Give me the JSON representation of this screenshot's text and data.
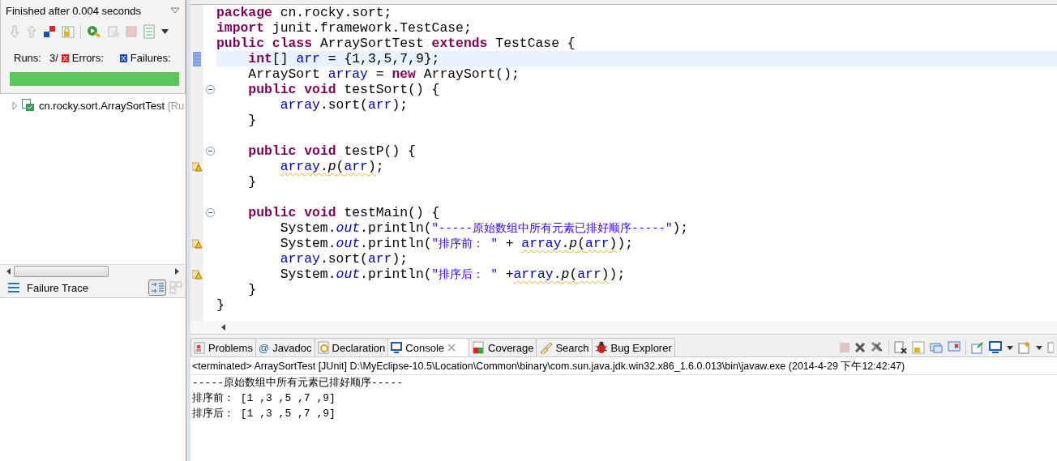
{
  "junit": {
    "status": "Finished after 0.004 seconds",
    "runs_label": "Runs:",
    "runs": "3/",
    "errors_label": "Errors:",
    "failures_label": "Failures:",
    "progress": {
      "level": 1
    },
    "tree": [
      {
        "label": "cn.rocky.sort.ArraySortTest",
        "suffix": "[Ru",
        "expanded": false
      }
    ],
    "failure_trace": "Failure Trace"
  },
  "editor": {
    "lines": [
      {
        "gap_before": false,
        "current": false,
        "tokens": [
          {
            "text": "package",
            "kind": "keyword",
            "squiggle": false
          },
          {
            "text": " cn.rocky.sort;",
            "kind": "plain",
            "squiggle": false
          }
        ]
      },
      {
        "gap_before": false,
        "current": false,
        "tokens": [
          {
            "text": "import",
            "kind": "keyword",
            "squiggle": false
          },
          {
            "text": " junit.framework.TestCase;",
            "kind": "plain",
            "squiggle": false
          }
        ]
      },
      {
        "gap_before": false,
        "current": false,
        "tokens": [
          {
            "text": "public ",
            "kind": "keyword",
            "squiggle": false
          },
          {
            "text": "class",
            "kind": "keyword",
            "squiggle": false
          },
          {
            "text": " ArraySortTest ",
            "kind": "plain",
            "squiggle": false
          },
          {
            "text": "extends",
            "kind": "keyword",
            "squiggle": false
          },
          {
            "text": " TestCase {",
            "kind": "plain",
            "squiggle": false
          }
        ],
        "children": [
          {
            "kind": "bookmark",
            "gap_before": false,
            "current": true,
            "tokens": [
              {
                "text": "int",
                "kind": "keyword",
                "squiggle": false
              },
              {
                "text": "[] ",
                "kind": "plain",
                "squiggle": false
              },
              {
                "text": "arr",
                "kind": "field",
                "squiggle": false
              },
              {
                "text": " = {1,3,5,7,9};",
                "kind": "plain",
                "squiggle": false
              }
            ]
          },
          {
            "gap_before": false,
            "current": false,
            "tokens": [
              {
                "text": "ArraySort ",
                "kind": "plain",
                "squiggle": false
              },
              {
                "text": "array",
                "kind": "field",
                "squiggle": false
              },
              {
                "text": " = ",
                "kind": "plain",
                "squiggle": false
              },
              {
                "text": "new",
                "kind": "keyword",
                "squiggle": false
              },
              {
                "text": " ArraySort();",
                "kind": "plain",
                "squiggle": false
              }
            ]
          },
          {
            "kind": "fold",
            "gap_before": false,
            "current": false,
            "tokens": [
              {
                "text": "public ",
                "kind": "keyword",
                "squiggle": false
              },
              {
                "text": "void",
                "kind": "keyword",
                "squiggle": false
              },
              {
                "text": " testSort() {",
                "kind": "plain",
                "squiggle": false
              }
            ],
            "children": [
              {
                "gap_before": false,
                "current": false,
                "tokens": [
                  {
                    "text": "array",
                    "kind": "field",
                    "squiggle": false
                  },
                  {
                    "text": ".sort(",
                    "kind": "plain",
                    "squiggle": false
                  },
                  {
                    "text": "arr",
                    "kind": "field",
                    "squiggle": false
                  },
                  {
                    "text": ");",
                    "kind": "plain",
                    "squiggle": false
                  }
                ]
              }
            ]
          },
          {
            "gap_before": false,
            "current": false,
            "tokens": [
              {
                "text": "}",
                "kind": "plain",
                "squiggle": false
              }
            ]
          },
          {
            "kind": "fold",
            "gap_before": true,
            "current": false,
            "tokens": [
              {
                "text": "public ",
                "kind": "keyword",
                "squiggle": false
              },
              {
                "text": "void",
                "kind": "keyword",
                "squiggle": false
              },
              {
                "text": " testP() {",
                "kind": "plain",
                "squiggle": false
              }
            ],
            "children": [
              {
                "kind": "warning",
                "gap_before": false,
                "current": false,
                "tokens": [
                  {
                    "text": "array",
                    "kind": "field",
                    "squiggle": true
                  },
                  {
                    "text": ".",
                    "kind": "plain",
                    "squiggle": true
                  },
                  {
                    "text": "p",
                    "kind": "static_method",
                    "squiggle": true
                  },
                  {
                    "text": "(",
                    "kind": "plain",
                    "squiggle": true
                  },
                  {
                    "text": "arr",
                    "kind": "field",
                    "squiggle": true
                  },
                  {
                    "text": ")",
                    "kind": "plain",
                    "squiggle": true
                  },
                  {
                    "text": ";",
                    "kind": "plain",
                    "squiggle": false
                  }
                ]
              }
            ]
          },
          {
            "gap_before": false,
            "current": false,
            "tokens": [
              {
                "text": "}",
                "kind": "plain",
                "squiggle": false
              }
            ]
          },
          {
            "kind": "fold",
            "gap_before": true,
            "current": false,
            "tokens": [
              {
                "text": "public ",
                "kind": "keyword",
                "squiggle": false
              },
              {
                "text": "void",
                "kind": "keyword",
                "squiggle": false
              },
              {
                "text": " testMain() {",
                "kind": "plain",
                "squiggle": false
              }
            ],
            "children": [
              {
                "gap_before": false,
                "current": false,
                "tokens": [
                  {
                    "text": "System.",
                    "kind": "plain",
                    "squiggle": false
                  },
                  {
                    "text": "out",
                    "kind": "static",
                    "squiggle": false
                  },
                  {
                    "text": ".println(",
                    "kind": "plain",
                    "squiggle": false
                  },
                  {
                    "text": "\"-----原始数组中所有元素已排好顺序-----\"",
                    "kind": "string",
                    "squiggle": false
                  },
                  {
                    "text": ");",
                    "kind": "plain",
                    "squiggle": false
                  }
                ]
              },
              {
                "kind": "warning",
                "gap_before": false,
                "current": false,
                "tokens": [
                  {
                    "text": "System.",
                    "kind": "plain",
                    "squiggle": false
                  },
                  {
                    "text": "out",
                    "kind": "static",
                    "squiggle": false
                  },
                  {
                    "text": ".println(",
                    "kind": "plain",
                    "squiggle": false
                  },
                  {
                    "text": "\"排序前： \"",
                    "kind": "string",
                    "squiggle": false
                  },
                  {
                    "text": " + ",
                    "kind": "plain",
                    "squiggle": false
                  },
                  {
                    "text": "array",
                    "kind": "field",
                    "squiggle": true
                  },
                  {
                    "text": ".",
                    "kind": "plain",
                    "squiggle": true
                  },
                  {
                    "text": "p",
                    "kind": "static_method",
                    "squiggle": true
                  },
                  {
                    "text": "(",
                    "kind": "plain",
                    "squiggle": true
                  },
                  {
                    "text": "arr",
                    "kind": "field",
                    "squiggle": true
                  },
                  {
                    "text": ")",
                    "kind": "plain",
                    "squiggle": true
                  },
                  {
                    "text": ");",
                    "kind": "plain",
                    "squiggle": false
                  }
                ]
              },
              {
                "gap_before": false,
                "current": false,
                "tokens": [
                  {
                    "text": "array",
                    "kind": "field",
                    "squiggle": false
                  },
                  {
                    "text": ".sort(",
                    "kind": "plain",
                    "squiggle": false
                  },
                  {
                    "text": "arr",
                    "kind": "field",
                    "squiggle": false
                  },
                  {
                    "text": ");",
                    "kind": "plain",
                    "squiggle": false
                  }
                ]
              },
              {
                "kind": "warning",
                "gap_before": false,
                "current": false,
                "tokens": [
                  {
                    "text": "System.",
                    "kind": "plain",
                    "squiggle": false
                  },
                  {
                    "text": "out",
                    "kind": "static",
                    "squiggle": false
                  },
                  {
                    "text": ".println(",
                    "kind": "plain",
                    "squiggle": false
                  },
                  {
                    "text": "\"排序后： \"",
                    "kind": "string",
                    "squiggle": false
                  },
                  {
                    "text": " +",
                    "kind": "plain",
                    "squiggle": false
                  },
                  {
                    "text": "array",
                    "kind": "field",
                    "squiggle": true
                  },
                  {
                    "text": ".",
                    "kind": "plain",
                    "squiggle": true
                  },
                  {
                    "text": "p",
                    "kind": "static_method",
                    "squiggle": true
                  },
                  {
                    "text": "(",
                    "kind": "plain",
                    "squiggle": true
                  },
                  {
                    "text": "arr",
                    "kind": "field",
                    "squiggle": true
                  },
                  {
                    "text": ")",
                    "kind": "plain",
                    "squiggle": true
                  },
                  {
                    "text": ");",
                    "kind": "plain",
                    "squiggle": false
                  }
                ]
              }
            ]
          },
          {
            "gap_before": false,
            "current": false,
            "tokens": [
              {
                "text": "}",
                "kind": "plain",
                "squiggle": false
              }
            ]
          }
        ]
      },
      {
        "gap_before": false,
        "current": false,
        "tokens": [
          {
            "text": "}",
            "kind": "plain",
            "squiggle": false
          }
        ]
      }
    ]
  },
  "console": {
    "tabs": [
      {
        "label": "Problems",
        "selected": false
      },
      {
        "label": "Javadoc",
        "glyph": "@",
        "selected": false
      },
      {
        "label": "Declaration",
        "selected": false
      },
      {
        "label": "Console",
        "selected": true
      },
      {
        "label": "Coverage",
        "selected": false
      },
      {
        "label": "Search",
        "selected": false
      },
      {
        "label": "Bug Explorer",
        "selected": false
      }
    ],
    "header": "<terminated> ArraySortTest [JUnit] D:\\MyEclipse-10.5\\Location\\Common\\binary\\com.sun.java.jdk.win32.x86_1.6.0.013\\bin\\javaw.exe (2014-4-29 下午12:42:47)",
    "output": [
      "-----原始数组中所有元素已排好顺序-----",
      "排序前： [1 ,3 ,5 ,7 ,9]",
      "排序后： [1 ,3 ,5 ,7 ,9]"
    ]
  }
}
